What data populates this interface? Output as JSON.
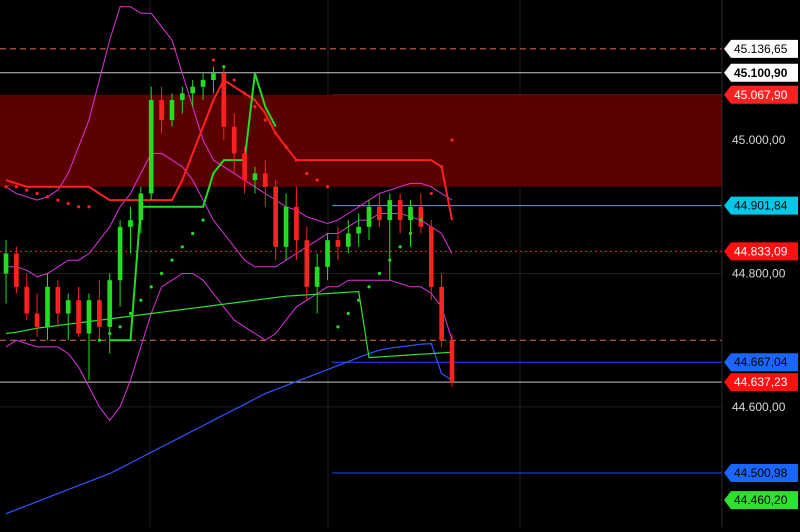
{
  "chart_data": {
    "type": "candlestick",
    "grid": true,
    "ylim": [
      44420,
      45210
    ],
    "legend": "none",
    "y_ticks": [
      "45.000,00",
      "44.800,00",
      "44.600,00"
    ],
    "y_tick_values": [
      45000,
      44800,
      44600
    ],
    "resistance_zone": {
      "top": 45067.9,
      "bottom": 44930,
      "color": "#5a0000"
    },
    "price_labels": [
      {
        "text": "45.136,65",
        "value": 45136.65,
        "bg": "#ffffff",
        "fg": "#000000",
        "line": "#e07050",
        "line_style": "dashed",
        "line_from": 0
      },
      {
        "text": "45.100,90",
        "value": 45100.9,
        "bg": "#ffffff",
        "fg": "#000000",
        "line": "#c8c8c8",
        "line_style": "solid",
        "line_from": 0
      },
      {
        "text": "45.067,90",
        "value": 45067.9,
        "bg": "#ff2020",
        "fg": "#ffffff",
        "line": "#6a1a1a",
        "line_style": "solid",
        "line_from": 0.46
      },
      {
        "text": "44.901,84",
        "value": 44901.84,
        "bg": "#00c8e6",
        "fg": "#000000",
        "line": "#00c8e6",
        "line_style": "solid",
        "line_from": 0.46
      },
      {
        "text": "44.833,09",
        "value": 44833.09,
        "bg": "#ff1010",
        "fg": "#ffffff",
        "line": "#ff2020",
        "line_style": "dotted",
        "line_from": 0
      },
      {
        "text": "44.667,04",
        "value": 44667.04,
        "bg": "#1a66ff",
        "fg": "#000000",
        "line": "#1a4aff",
        "line_style": "solid",
        "line_from": 0.46
      },
      {
        "text": "44.637,23",
        "value": 44637.23,
        "bg": "#ff1010",
        "fg": "#ffffff",
        "line": "#c8c8c8",
        "line_style": "solid",
        "line_from": 0
      },
      {
        "text": "44.500,98",
        "value": 44500.98,
        "bg": "#1a66ff",
        "fg": "#000000",
        "line": "#1a4aff",
        "line_style": "solid",
        "line_from": 0.46
      },
      {
        "text": "44.460,20",
        "value": 44460.2,
        "bg": "#30e030",
        "fg": "#000000",
        "line": "",
        "line_style": "none",
        "line_from": 0
      }
    ],
    "extra_lines": [
      {
        "value": 44700,
        "color": "#e07050",
        "style": "dashed"
      }
    ],
    "colors": {
      "up": "#22dd22",
      "down": "#ff2020",
      "bollinger": "#dd33dd",
      "ma_fast": "#33dd33",
      "ma_slow": "#3355ff",
      "psar": "#ff2020"
    },
    "candles": [
      [
        44800,
        44850,
        44755,
        44830
      ],
      [
        44830,
        44840,
        44770,
        44780
      ],
      [
        44780,
        44800,
        44730,
        44740
      ],
      [
        44740,
        44770,
        44705,
        44720
      ],
      [
        44720,
        44800,
        44700,
        44780
      ],
      [
        44780,
        44790,
        44720,
        44740
      ],
      [
        44740,
        44770,
        44700,
        44760
      ],
      [
        44760,
        44780,
        44705,
        44710
      ],
      [
        44710,
        44770,
        44640,
        44760
      ],
      [
        44760,
        44790,
        44700,
        44720
      ],
      [
        44720,
        44800,
        44680,
        44790
      ],
      [
        44790,
        44880,
        44750,
        44870
      ],
      [
        44870,
        44900,
        44830,
        44880
      ],
      [
        44880,
        44930,
        44860,
        44920
      ],
      [
        44920,
        45080,
        44910,
        45060
      ],
      [
        45060,
        45080,
        45010,
        45030
      ],
      [
        45030,
        45070,
        45020,
        45060
      ],
      [
        45060,
        45080,
        45040,
        45070
      ],
      [
        45070,
        45090,
        45050,
        45080
      ],
      [
        45080,
        45100,
        45060,
        45090
      ],
      [
        45090,
        45110,
        45070,
        45100
      ],
      [
        45100,
        45110,
        45000,
        45020
      ],
      [
        45020,
        45040,
        44950,
        44980
      ],
      [
        44980,
        44990,
        44920,
        44940
      ],
      [
        44940,
        44960,
        44920,
        44950
      ],
      [
        44950,
        44970,
        44900,
        44930
      ],
      [
        44930,
        44940,
        44820,
        44840
      ],
      [
        44840,
        44920,
        44820,
        44900
      ],
      [
        44900,
        44930,
        44820,
        44850
      ],
      [
        44850,
        44870,
        44760,
        44780
      ],
      [
        44780,
        44830,
        44740,
        44810
      ],
      [
        44810,
        44860,
        44790,
        44850
      ],
      [
        44850,
        44870,
        44820,
        44840
      ],
      [
        44840,
        44880,
        44830,
        44860
      ],
      [
        44860,
        44890,
        44840,
        44870
      ],
      [
        44870,
        44910,
        44850,
        44900
      ],
      [
        44900,
        44920,
        44870,
        44880
      ],
      [
        44880,
        44920,
        44790,
        44910
      ],
      [
        44910,
        44920,
        44860,
        44880
      ],
      [
        44880,
        44910,
        44840,
        44900
      ],
      [
        44900,
        44920,
        44860,
        44870
      ],
      [
        44870,
        44880,
        44760,
        44780
      ],
      [
        44780,
        44800,
        44690,
        44700
      ],
      [
        44700,
        44710,
        44630,
        44637.23
      ]
    ],
    "bollinger_upper": [
      44930,
      44920,
      44915,
      44910,
      44915,
      44925,
      44950,
      44990,
      45030,
      45090,
      45150,
      45200,
      45200,
      45190,
      45190,
      45170,
      45150,
      45100,
      45050,
      45000,
      44970,
      44960,
      44950,
      44940,
      44930,
      44920,
      44910,
      44900,
      44895,
      44885,
      44880,
      44875,
      44880,
      44890,
      44900,
      44910,
      44920,
      44925,
      44930,
      44935,
      44935,
      44930,
      44920,
      44910
    ],
    "bollinger_middle": [
      44810,
      44810,
      44805,
      44795,
      44800,
      44810,
      44820,
      44820,
      44830,
      44850,
      44870,
      44900,
      44920,
      44950,
      44980,
      44980,
      44970,
      44960,
      44940,
      44910,
      44880,
      44860,
      44840,
      44820,
      44810,
      44810,
      44810,
      44820,
      44830,
      44840,
      44850,
      44860,
      44860,
      44870,
      44880,
      44880,
      44890,
      44890,
      44890,
      44885,
      44880,
      44870,
      44860,
      44830
    ],
    "bollinger_lower": [
      44690,
      44700,
      44695,
      44690,
      44690,
      44690,
      44680,
      44660,
      44630,
      44600,
      44580,
      44600,
      44640,
      44690,
      44740,
      44780,
      44790,
      44800,
      44800,
      44790,
      44770,
      44750,
      44730,
      44720,
      44710,
      44700,
      44710,
      44730,
      44750,
      44760,
      44770,
      44780,
      44780,
      44790,
      44790,
      44790,
      44790,
      44790,
      44785,
      44780,
      44780,
      44770,
      44750,
      44700
    ],
    "ma_fast": [
      44710,
      44712,
      44715,
      44718,
      44720,
      44722,
      44724,
      44726,
      44728,
      44730,
      44732,
      44734,
      44736,
      44738,
      44740,
      44742,
      44744,
      44746,
      44748,
      44750,
      44752,
      44754,
      44756,
      44758,
      44760,
      44762,
      44764,
      44766,
      44767,
      44768,
      44769,
      44770,
      44771,
      44772,
      44773,
      44674,
      44675,
      44676,
      44677,
      44678,
      44679,
      44680,
      44681,
      44682
    ],
    "ma_slow": [
      44440,
      44446,
      44452,
      44458,
      44464,
      44470,
      44476,
      44482,
      44488,
      44494,
      44500,
      44508,
      44516,
      44524,
      44532,
      44540,
      44548,
      44556,
      44564,
      44572,
      44580,
      44588,
      44596,
      44604,
      44612,
      44620,
      44626,
      44632,
      44638,
      44644,
      44650,
      44656,
      44662,
      44668,
      44674,
      44680,
      44685,
      44688,
      44690,
      44692,
      44694,
      44695,
      44650,
      44640
    ],
    "trend_line_red": [
      44940,
      44935,
      44930,
      44930,
      44930,
      44930,
      44930,
      44930,
      44930,
      44920,
      44910,
      44910,
      44910,
      44910,
      44910,
      44910,
      44910,
      44940,
      44980,
      45020,
      45060,
      45090,
      45080,
      45070,
      45060,
      45040,
      45010,
      44990,
      44970,
      44970,
      44970,
      44970,
      44970,
      44970,
      44970,
      44970,
      44970,
      44970,
      44970,
      44970,
      44970,
      44970,
      44960,
      44880
    ],
    "trend_line_green": [
      null,
      null,
      null,
      null,
      null,
      null,
      null,
      null,
      null,
      null,
      44700,
      44700,
      44700,
      44900,
      44900,
      44900,
      44900,
      44900,
      44900,
      44900,
      44950,
      44970,
      44970,
      44970,
      45100,
      45050,
      45020,
      null,
      null,
      null,
      null,
      null,
      null,
      null,
      null,
      null,
      null,
      null,
      null,
      null,
      null,
      null,
      null,
      null
    ],
    "psar": [
      44930,
      44930,
      44925,
      44920,
      44915,
      44910,
      44905,
      44900,
      44900,
      44700,
      44710,
      44720,
      44740,
      44760,
      44780,
      44800,
      44820,
      44840,
      44860,
      44880,
      45120,
      45110,
      45090,
      45070,
      45050,
      45030,
      45010,
      44990,
      44970,
      44950,
      44940,
      44930,
      44720,
      44740,
      44760,
      44780,
      44800,
      44820,
      44840,
      44860,
      44880,
      44920,
      44960,
      45000
    ]
  }
}
